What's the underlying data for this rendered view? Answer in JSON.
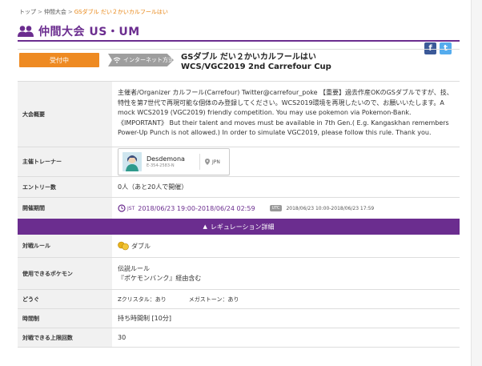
{
  "breadcrumb": [
    "トップ",
    "仲間大会",
    "GSダブル だい２かいカルフールはい"
  ],
  "page_title": "仲間大会 US・UM",
  "share": {
    "facebook": "f",
    "twitter": "t"
  },
  "status": "受付中",
  "network": "インターネット方式",
  "event_title_line1": "GSダブル だい２かいカルフールはい",
  "event_title_line2": "WCS/VGC2019 2nd Carrefour Cup",
  "labels": {
    "overview": "大会概要",
    "organizer": "主催トレーナー",
    "entries": "エントリー数",
    "period": "開催期間",
    "rule": "対戦ルール",
    "pokemon": "使用できるポケモン",
    "items": "どうぐ",
    "time": "時間制",
    "limit": "対戦できる上限回数"
  },
  "overview_text": "主催者/Organizer カルフール(Carrefour) Twitter@carrefour_poke 【重要】過去作産OKのGSダブルですが、技、特性を第7世代で再現可能な個体のみ登録してください。WCS2019環境を再現したいので、お願いいたします。A mock WCS2019 (VGC2019) friendly competition. You may use pokemon via Pokemon-Bank. 《IMPORTANT》 But their talent and moves must be available in 7th Gen.( E.g. Kangaskhan remembers Power-Up Punch is not allowed.) In order to simulate VGC2019, please follow this rule. Thank you.",
  "trainer": {
    "name": "Desdemona",
    "id": "E-354-2583-N",
    "region": "JPN"
  },
  "entries": "0人（あと20人で開催）",
  "period": {
    "jst_label": "JST",
    "jst": "2018/06/23 19:00-2018/06/24 02:59",
    "utc_label": "UTC",
    "utc": "2018/06/23 10:00-2018/06/23 17:59"
  },
  "regulation_bar": "レギュレーション詳細",
  "rule": "ダブル",
  "pokemon_line1": "伝説ルール",
  "pokemon_line2": "『ポケモンバンク』経由含む",
  "items": {
    "z_crystal": "Zクリスタル：あり",
    "mega_stone": "メガストーン：あり"
  },
  "time": "持ち時間制 [10分]",
  "limit": "30"
}
